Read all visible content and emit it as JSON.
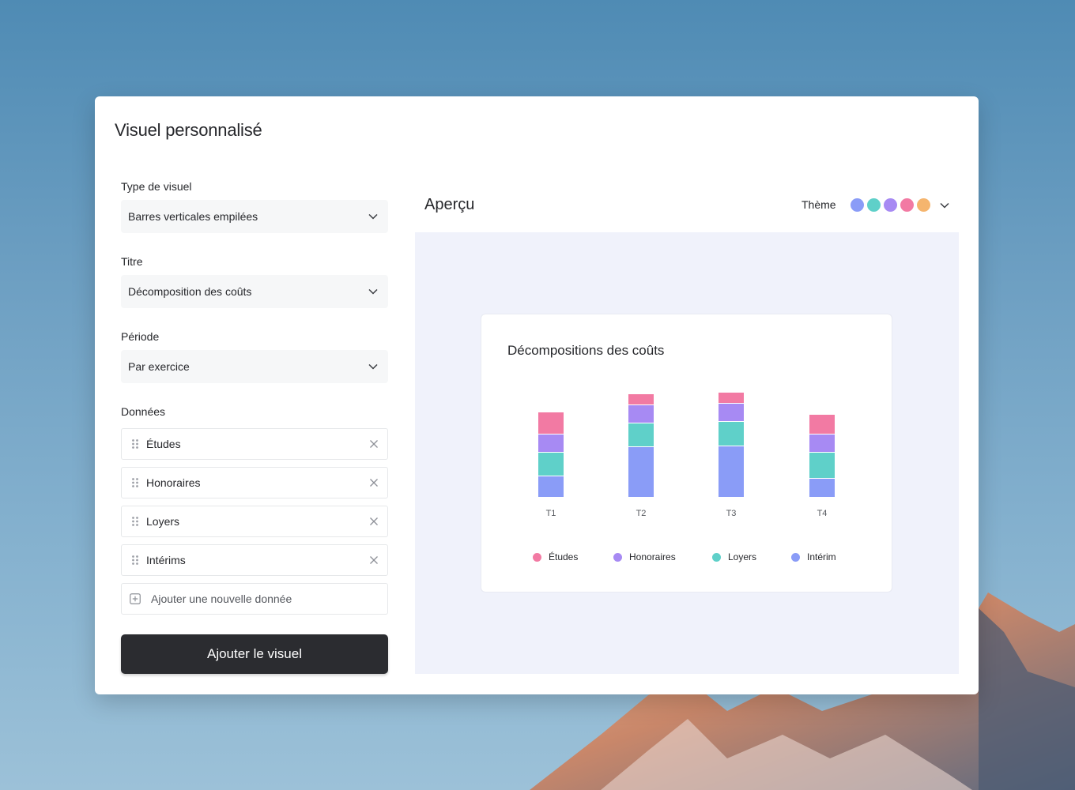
{
  "dialog": {
    "title": "Visuel personnalisé"
  },
  "form": {
    "type_label": "Type de visuel",
    "type_value": "Barres verticales empilées",
    "title_label": "Titre",
    "title_value": "Décomposition des coûts",
    "period_label": "Période",
    "period_value": "Par exercice",
    "data_label": "Données",
    "data_items": [
      "Études",
      "Honoraires",
      "Loyers",
      "Intérims"
    ],
    "add_data_label": "Ajouter une nouvelle donnée",
    "submit_label": "Ajouter le visuel"
  },
  "preview": {
    "title": "Aperçu",
    "theme_label": "Thème",
    "theme_colors": [
      "#8a9cf7",
      "#5fd0c9",
      "#a78af3",
      "#f27aa3",
      "#f5b56e"
    ]
  },
  "chart_data": {
    "type": "bar",
    "stacked": true,
    "title": "Décompositions des coûts",
    "categories": [
      "T1",
      "T2",
      "T3",
      "T4"
    ],
    "series": [
      {
        "name": "Intérim",
        "color": "#8a9cf7",
        "values": [
          27,
          64,
          65,
          24
        ]
      },
      {
        "name": "Loyers",
        "color": "#5fd0c9",
        "values": [
          30,
          30,
          31,
          33
        ]
      },
      {
        "name": "Honoraires",
        "color": "#a78af3",
        "values": [
          23,
          23,
          23,
          23
        ]
      },
      {
        "name": "Études",
        "color": "#f27aa3",
        "values": [
          28,
          14,
          14,
          25
        ]
      }
    ],
    "legend_order": [
      "Études",
      "Honoraires",
      "Loyers",
      "Intérim"
    ],
    "legend_placement": "bottom",
    "grid": false,
    "ylim": [
      0,
      140
    ]
  }
}
